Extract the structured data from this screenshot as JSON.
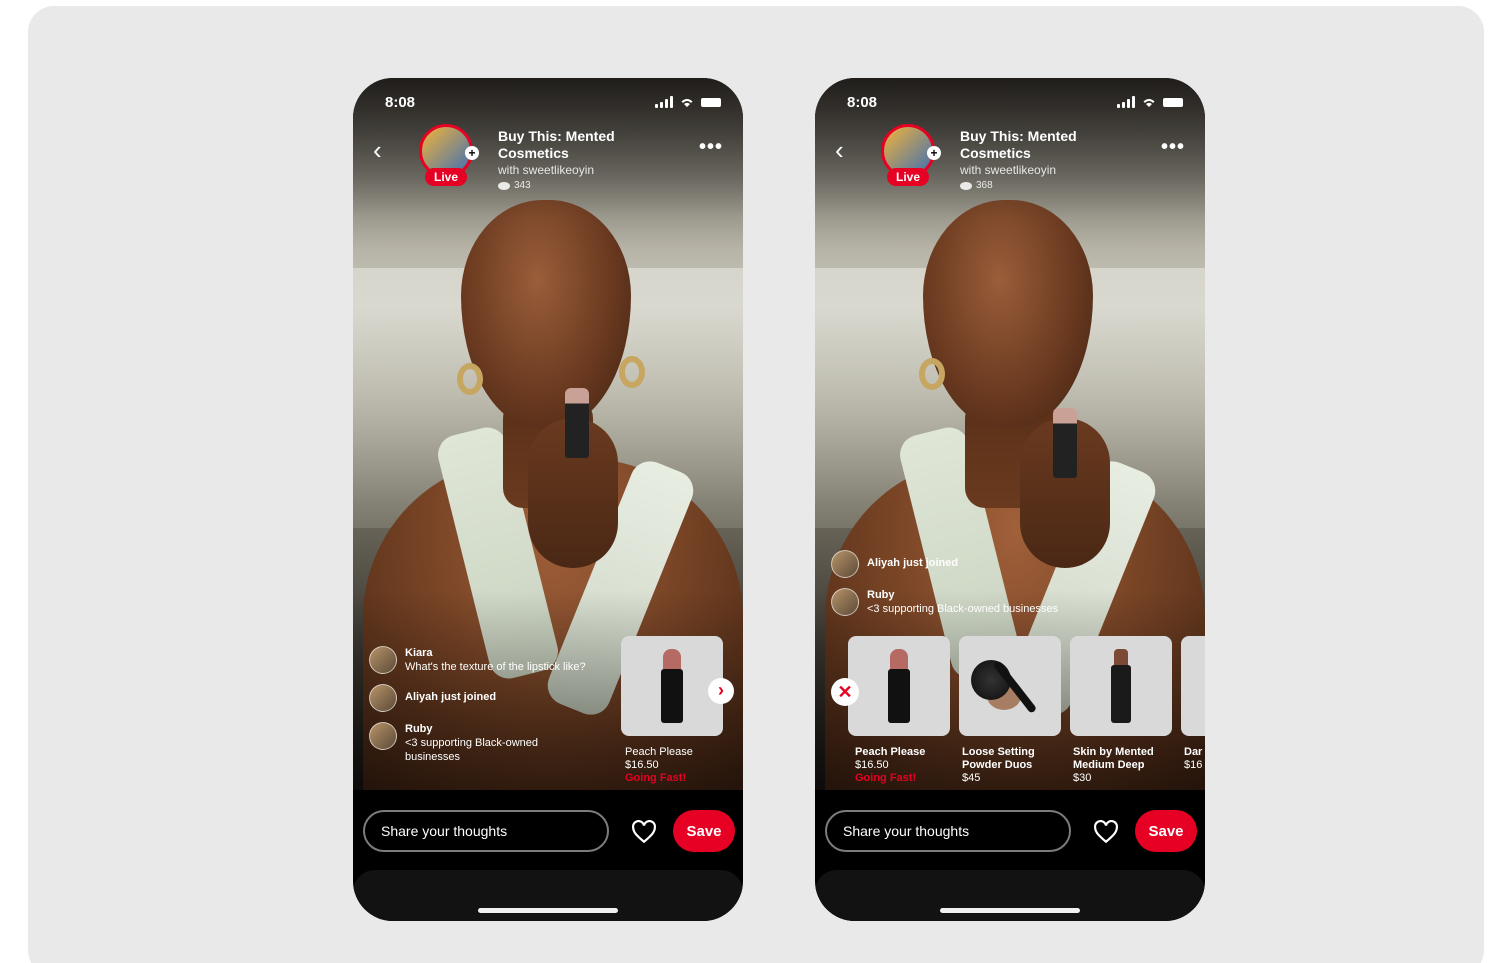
{
  "phones": [
    {
      "status_time": "8:08",
      "header": {
        "title": "Buy This: Mented Cosmetics",
        "subtitle": "with sweetlikeoyin",
        "viewers": "343",
        "live_badge": "Live"
      },
      "comments": [
        {
          "name": "Kiara",
          "text": "What's the texture of the lipstick like?"
        },
        {
          "name": "",
          "text": "Aliyah just joined"
        },
        {
          "name": "Ruby",
          "text": "<3 supporting Black-owned businesses"
        }
      ],
      "product": {
        "name": "Peach Please",
        "price": "$16.50",
        "badge": "Going Fast!"
      },
      "share_placeholder": "Share your thoughts",
      "save_label": "Save"
    },
    {
      "status_time": "8:08",
      "header": {
        "title": "Buy This: Mented Cosmetics",
        "subtitle": "with sweetlikeoyin",
        "viewers": "368",
        "live_badge": "Live"
      },
      "comments": [
        {
          "name": "",
          "text": "Aliyah just joined"
        },
        {
          "name": "Ruby",
          "text": "<3 supporting Black-owned businesses"
        }
      ],
      "products": [
        {
          "name": "Peach Please",
          "price": "$16.50",
          "badge": "Going Fast!"
        },
        {
          "name": "Loose Setting Powder Duos",
          "price": "$45"
        },
        {
          "name": "Skin by Mented Medium Deep",
          "price": "$30"
        },
        {
          "name": "Dar",
          "price": "$16"
        }
      ],
      "share_placeholder": "Share your thoughts",
      "save_label": "Save"
    }
  ],
  "colors": {
    "brand_red": "#e60023",
    "background": "#e9e9e9"
  },
  "icons": [
    "back-chevron-icon",
    "more-icon",
    "heart-icon",
    "eye-icon",
    "close-icon",
    "next-chevron-icon",
    "signal-icon",
    "wifi-icon",
    "battery-icon"
  ]
}
